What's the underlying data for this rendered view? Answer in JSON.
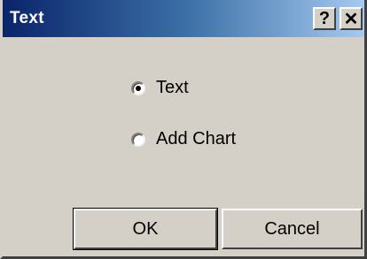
{
  "window": {
    "title": "Text",
    "help_label": "?",
    "close_label": "✕"
  },
  "options": [
    {
      "label": "Text",
      "selected": true
    },
    {
      "label": "Add Chart",
      "selected": false
    }
  ],
  "buttons": {
    "ok_label": "OK",
    "cancel_label": "Cancel"
  },
  "colors": {
    "titlebar_start": "#0a246a",
    "titlebar_end": "#a6caf0",
    "dialog_face": "#d4d0c8"
  }
}
